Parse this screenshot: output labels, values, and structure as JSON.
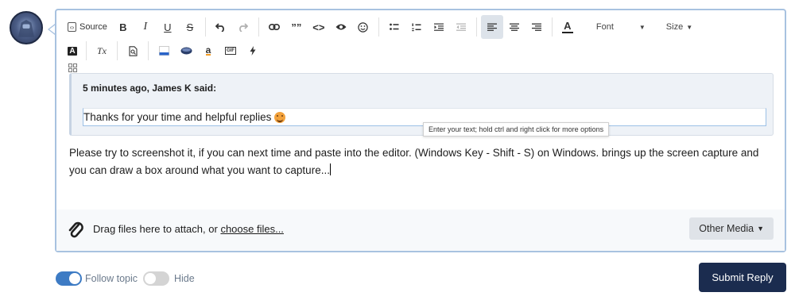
{
  "toolbar": {
    "source_label": "Source",
    "bold_label": "B",
    "italic_label": "I",
    "underline_label": "U",
    "strike_label": "S",
    "font_label": "Font",
    "size_label": "Size",
    "text_color_glyph": "A",
    "bg_color_glyph": "A",
    "clear_format_glyph": "Tx",
    "quote_glyph": "””",
    "code_glyph": "<>",
    "gif_glyph": "GIF",
    "amazon_glyph": "a"
  },
  "icons": {
    "undo": "undo-icon",
    "redo": "redo-icon",
    "link": "link-icon",
    "preview": "eye-icon",
    "emoji": "smiley-icon",
    "bullets": "bullet-list-icon",
    "numbered": "numbered-list-icon",
    "indent": "indent-icon",
    "outdent": "outdent-icon",
    "align_left": "align-left-icon",
    "align_center": "align-center-icon",
    "align_right": "align-right-icon",
    "find": "find-replace-icon",
    "bg_stripe": "color-stripe-icon",
    "cloud": "cloud-icon",
    "lightning": "lightning-icon",
    "attach": "paperclip-icon"
  },
  "quote": {
    "header": "5 minutes ago, James K said:",
    "body": "Thanks for your time and helpful replies",
    "tooltip": "Enter your text; hold ctrl and right click for more options"
  },
  "editor": {
    "content": "Please try to screenshot it, if you can next time and paste into the editor. (Windows Key - Shift - S) on Windows. brings up the screen capture and you can draw a box around what you want to capture..."
  },
  "attach": {
    "prefix": "Drag files here to attach, or",
    "link": "choose files...",
    "other_media": "Other Media"
  },
  "footer": {
    "follow_label": "Follow topic",
    "follow_on": true,
    "hide_label": "Hide",
    "hide_on": false,
    "submit_label": "Submit Reply"
  },
  "colors": {
    "accent": "#3d7bc4",
    "submit_bg": "#1b2c4f",
    "editor_border": "#a8c2e0",
    "quote_bg": "#eef2f7"
  }
}
